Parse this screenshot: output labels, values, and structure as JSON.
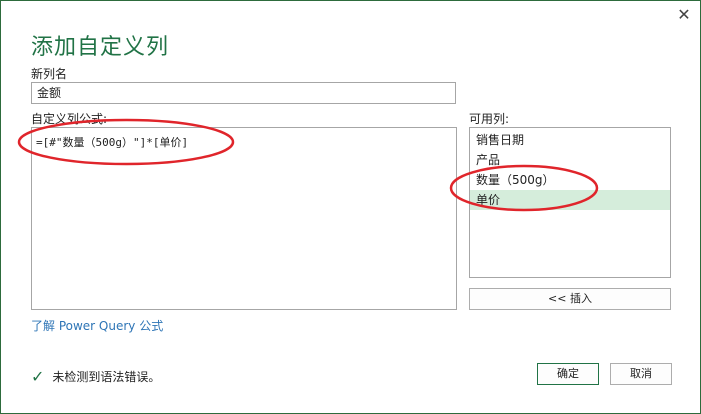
{
  "dialog": {
    "title": "添加自定义列",
    "close_glyph": "✕"
  },
  "new_column": {
    "label": "新列名",
    "value": "金额"
  },
  "formula": {
    "label": "自定义列公式:",
    "value": "=[#\"数量（500g）\"]*[单价]"
  },
  "available_columns": {
    "label": "可用列:",
    "items": [
      {
        "label": "销售日期",
        "selected": false
      },
      {
        "label": "产品",
        "selected": false
      },
      {
        "label": "数量（500g）",
        "selected": false
      },
      {
        "label": "单价",
        "selected": true
      }
    ],
    "insert_label": "<< 插入"
  },
  "learn_link": "了解 Power Query 公式",
  "status": {
    "icon": "check-icon",
    "text": "未检测到语法错误。"
  },
  "buttons": {
    "ok": "确定",
    "cancel": "取消"
  },
  "colors": {
    "accent": "#217346",
    "annotation": "#e0252b",
    "selection": "#d5eddb",
    "link": "#2e75b6"
  }
}
